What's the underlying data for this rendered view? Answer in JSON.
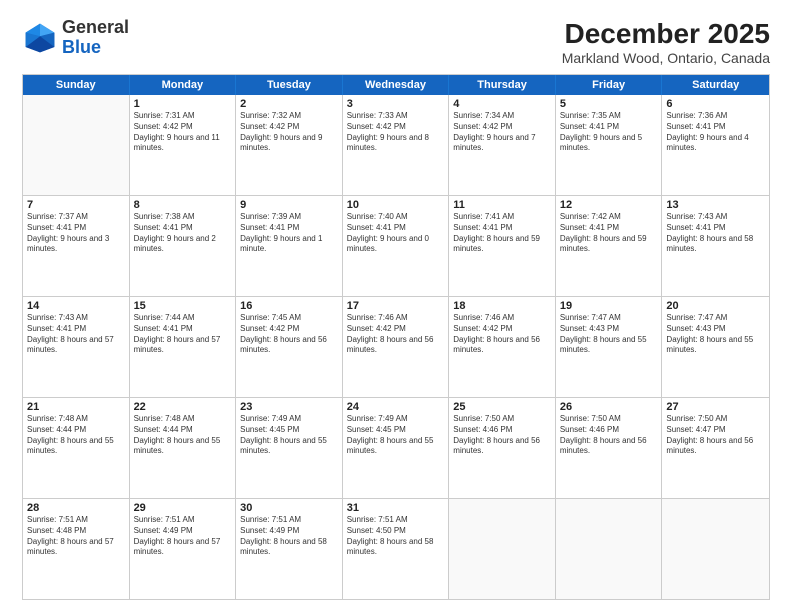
{
  "header": {
    "logo": {
      "general": "General",
      "blue": "Blue"
    },
    "title": "December 2025",
    "location": "Markland Wood, Ontario, Canada"
  },
  "calendar": {
    "days": [
      "Sunday",
      "Monday",
      "Tuesday",
      "Wednesday",
      "Thursday",
      "Friday",
      "Saturday"
    ],
    "rows": [
      [
        {
          "day": "",
          "empty": true
        },
        {
          "day": "1",
          "sunrise": "Sunrise: 7:31 AM",
          "sunset": "Sunset: 4:42 PM",
          "daylight": "Daylight: 9 hours and 11 minutes."
        },
        {
          "day": "2",
          "sunrise": "Sunrise: 7:32 AM",
          "sunset": "Sunset: 4:42 PM",
          "daylight": "Daylight: 9 hours and 9 minutes."
        },
        {
          "day": "3",
          "sunrise": "Sunrise: 7:33 AM",
          "sunset": "Sunset: 4:42 PM",
          "daylight": "Daylight: 9 hours and 8 minutes."
        },
        {
          "day": "4",
          "sunrise": "Sunrise: 7:34 AM",
          "sunset": "Sunset: 4:42 PM",
          "daylight": "Daylight: 9 hours and 7 minutes."
        },
        {
          "day": "5",
          "sunrise": "Sunrise: 7:35 AM",
          "sunset": "Sunset: 4:41 PM",
          "daylight": "Daylight: 9 hours and 5 minutes."
        },
        {
          "day": "6",
          "sunrise": "Sunrise: 7:36 AM",
          "sunset": "Sunset: 4:41 PM",
          "daylight": "Daylight: 9 hours and 4 minutes."
        }
      ],
      [
        {
          "day": "7",
          "sunrise": "Sunrise: 7:37 AM",
          "sunset": "Sunset: 4:41 PM",
          "daylight": "Daylight: 9 hours and 3 minutes."
        },
        {
          "day": "8",
          "sunrise": "Sunrise: 7:38 AM",
          "sunset": "Sunset: 4:41 PM",
          "daylight": "Daylight: 9 hours and 2 minutes."
        },
        {
          "day": "9",
          "sunrise": "Sunrise: 7:39 AM",
          "sunset": "Sunset: 4:41 PM",
          "daylight": "Daylight: 9 hours and 1 minute."
        },
        {
          "day": "10",
          "sunrise": "Sunrise: 7:40 AM",
          "sunset": "Sunset: 4:41 PM",
          "daylight": "Daylight: 9 hours and 0 minutes."
        },
        {
          "day": "11",
          "sunrise": "Sunrise: 7:41 AM",
          "sunset": "Sunset: 4:41 PM",
          "daylight": "Daylight: 8 hours and 59 minutes."
        },
        {
          "day": "12",
          "sunrise": "Sunrise: 7:42 AM",
          "sunset": "Sunset: 4:41 PM",
          "daylight": "Daylight: 8 hours and 59 minutes."
        },
        {
          "day": "13",
          "sunrise": "Sunrise: 7:43 AM",
          "sunset": "Sunset: 4:41 PM",
          "daylight": "Daylight: 8 hours and 58 minutes."
        }
      ],
      [
        {
          "day": "14",
          "sunrise": "Sunrise: 7:43 AM",
          "sunset": "Sunset: 4:41 PM",
          "daylight": "Daylight: 8 hours and 57 minutes."
        },
        {
          "day": "15",
          "sunrise": "Sunrise: 7:44 AM",
          "sunset": "Sunset: 4:41 PM",
          "daylight": "Daylight: 8 hours and 57 minutes."
        },
        {
          "day": "16",
          "sunrise": "Sunrise: 7:45 AM",
          "sunset": "Sunset: 4:42 PM",
          "daylight": "Daylight: 8 hours and 56 minutes."
        },
        {
          "day": "17",
          "sunrise": "Sunrise: 7:46 AM",
          "sunset": "Sunset: 4:42 PM",
          "daylight": "Daylight: 8 hours and 56 minutes."
        },
        {
          "day": "18",
          "sunrise": "Sunrise: 7:46 AM",
          "sunset": "Sunset: 4:42 PM",
          "daylight": "Daylight: 8 hours and 56 minutes."
        },
        {
          "day": "19",
          "sunrise": "Sunrise: 7:47 AM",
          "sunset": "Sunset: 4:43 PM",
          "daylight": "Daylight: 8 hours and 55 minutes."
        },
        {
          "day": "20",
          "sunrise": "Sunrise: 7:47 AM",
          "sunset": "Sunset: 4:43 PM",
          "daylight": "Daylight: 8 hours and 55 minutes."
        }
      ],
      [
        {
          "day": "21",
          "sunrise": "Sunrise: 7:48 AM",
          "sunset": "Sunset: 4:44 PM",
          "daylight": "Daylight: 8 hours and 55 minutes."
        },
        {
          "day": "22",
          "sunrise": "Sunrise: 7:48 AM",
          "sunset": "Sunset: 4:44 PM",
          "daylight": "Daylight: 8 hours and 55 minutes."
        },
        {
          "day": "23",
          "sunrise": "Sunrise: 7:49 AM",
          "sunset": "Sunset: 4:45 PM",
          "daylight": "Daylight: 8 hours and 55 minutes."
        },
        {
          "day": "24",
          "sunrise": "Sunrise: 7:49 AM",
          "sunset": "Sunset: 4:45 PM",
          "daylight": "Daylight: 8 hours and 55 minutes."
        },
        {
          "day": "25",
          "sunrise": "Sunrise: 7:50 AM",
          "sunset": "Sunset: 4:46 PM",
          "daylight": "Daylight: 8 hours and 56 minutes."
        },
        {
          "day": "26",
          "sunrise": "Sunrise: 7:50 AM",
          "sunset": "Sunset: 4:46 PM",
          "daylight": "Daylight: 8 hours and 56 minutes."
        },
        {
          "day": "27",
          "sunrise": "Sunrise: 7:50 AM",
          "sunset": "Sunset: 4:47 PM",
          "daylight": "Daylight: 8 hours and 56 minutes."
        }
      ],
      [
        {
          "day": "28",
          "sunrise": "Sunrise: 7:51 AM",
          "sunset": "Sunset: 4:48 PM",
          "daylight": "Daylight: 8 hours and 57 minutes."
        },
        {
          "day": "29",
          "sunrise": "Sunrise: 7:51 AM",
          "sunset": "Sunset: 4:49 PM",
          "daylight": "Daylight: 8 hours and 57 minutes."
        },
        {
          "day": "30",
          "sunrise": "Sunrise: 7:51 AM",
          "sunset": "Sunset: 4:49 PM",
          "daylight": "Daylight: 8 hours and 58 minutes."
        },
        {
          "day": "31",
          "sunrise": "Sunrise: 7:51 AM",
          "sunset": "Sunset: 4:50 PM",
          "daylight": "Daylight: 8 hours and 58 minutes."
        },
        {
          "day": "",
          "empty": true
        },
        {
          "day": "",
          "empty": true
        },
        {
          "day": "",
          "empty": true
        }
      ]
    ]
  }
}
